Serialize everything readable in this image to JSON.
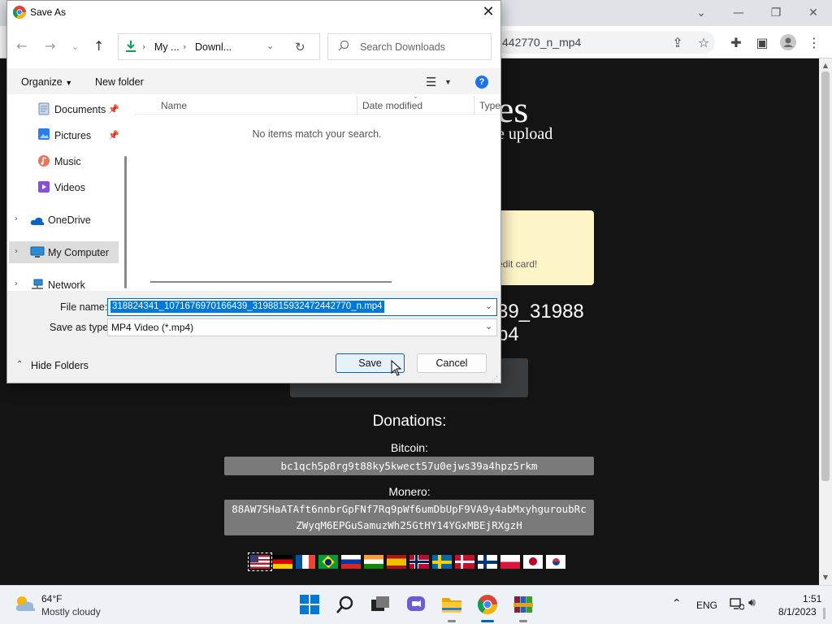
{
  "browser": {
    "url_fragment": "442770_n_mp4",
    "page_title_fragment": "es",
    "page_subtitle_fragment": "e upload",
    "notice_fragment": "edit card!",
    "filename_fragment_line1": "39_31988",
    "filename_fragment_line2": "p4",
    "donations_heading": "Donations:",
    "bitcoin_label": "Bitcoin:",
    "bitcoin_address": "bc1qch5p8rg9t88ky5kwect57u0ejws39a4hpz5rkm",
    "monero_label": "Monero:",
    "monero_address_line1": "88AW7SHaATAft6nnbrGpFNf7Rq9pWf6umDbUpF9VA9y4abMxyhguroubRc",
    "monero_address_line2": "ZWyqM6EPGuSamuzWh25GtHY14YGxMBEjRXgzH"
  },
  "dialog": {
    "title": "Save As",
    "breadcrumb": [
      "My ...",
      "Downl..."
    ],
    "search_placeholder": "Search Downloads",
    "organize_label": "Organize",
    "new_folder_label": "New folder",
    "nav_items": [
      {
        "label": "Documents",
        "icon": "documents-icon"
      },
      {
        "label": "Pictures",
        "icon": "pictures-icon"
      },
      {
        "label": "Music",
        "icon": "music-icon"
      },
      {
        "label": "Videos",
        "icon": "videos-icon"
      },
      {
        "label": "OneDrive",
        "icon": "onedrive-icon"
      },
      {
        "label": "My Computer",
        "icon": "computer-icon"
      },
      {
        "label": "Network",
        "icon": "network-icon"
      }
    ],
    "columns": [
      "Name",
      "Date modified",
      "Type"
    ],
    "empty_message": "No items match your search.",
    "file_name_label": "File name:",
    "file_name_value": "318824341_1071676970166439_3198815932472442770_n.mp4",
    "save_type_label": "Save as type:",
    "save_type_value": "MP4 Video (*.mp4)",
    "hide_folders_label": "Hide Folders",
    "save_label": "Save",
    "cancel_label": "Cancel"
  },
  "taskbar": {
    "weather_temp": "64°F",
    "weather_desc": "Mostly cloudy",
    "language": "ENG",
    "time": "1:51",
    "date": "8/1/2023"
  },
  "colors": {
    "accent": "#0067c0",
    "selection": "#0078d7",
    "page_bg": "#141414"
  }
}
